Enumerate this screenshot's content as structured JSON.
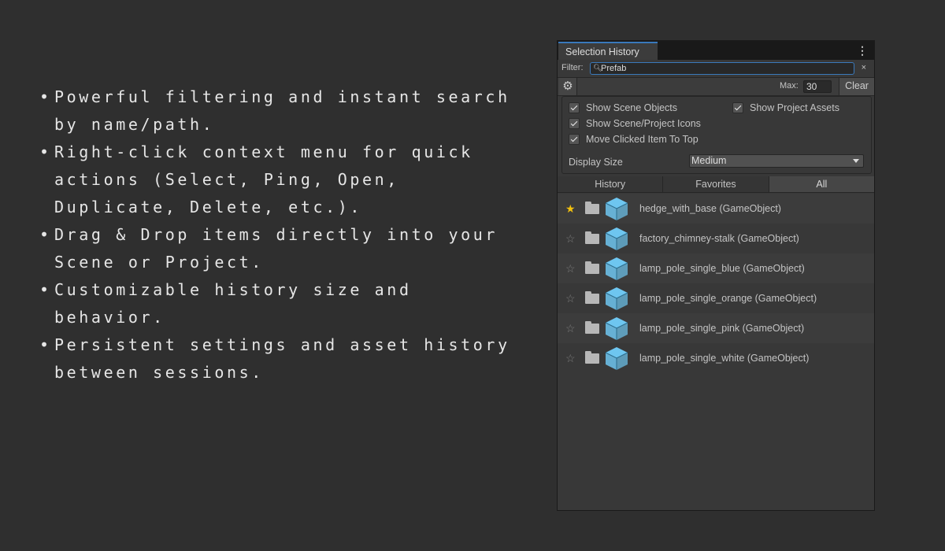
{
  "features": [
    {
      "bullet": "•",
      "text": "Powerful filtering and instant search by name/path."
    },
    {
      "bullet": "•",
      "text": "Right-click context menu for quick actions (Select, Ping, Open, Duplicate, Delete, etc.)."
    },
    {
      "bullet": "•",
      "text": "Drag & Drop items directly into your Scene or Project."
    },
    {
      "bullet": "•",
      "text": "Customizable history size and behavior."
    },
    {
      "bullet": "•",
      "text": "Persistent settings and asset history between sessions."
    }
  ],
  "window": {
    "title": "Selection History",
    "menu_icon": "kebab-menu-icon",
    "filter": {
      "label": "Filter:",
      "value": "Prefab",
      "search_icon": "search-icon",
      "clear_glyph": "×"
    },
    "toolbar": {
      "settings_icon": "gear-icon",
      "max_label": "Max:",
      "max_value": "30",
      "clear_label": "Clear"
    },
    "settings": {
      "show_scene_objects": {
        "label": "Show Scene Objects",
        "checked": true
      },
      "show_project_assets": {
        "label": "Show Project Assets",
        "checked": true
      },
      "show_icons": {
        "label": "Show Scene/Project Icons",
        "checked": true
      },
      "move_to_top": {
        "label": "Move Clicked Item To Top",
        "checked": true
      },
      "display_size_label": "Display Size",
      "display_size_value": "Medium"
    },
    "tabs": [
      {
        "label": "History",
        "active": false
      },
      {
        "label": "Favorites",
        "active": false
      },
      {
        "label": "All",
        "active": true
      }
    ],
    "items": [
      {
        "name": "hedge_with_base (GameObject)",
        "favorite": true
      },
      {
        "name": "factory_chimney-stalk (GameObject)",
        "favorite": false
      },
      {
        "name": "lamp_pole_single_blue (GameObject)",
        "favorite": false
      },
      {
        "name": "lamp_pole_single_orange (GameObject)",
        "favorite": false
      },
      {
        "name": "lamp_pole_single_pink (GameObject)",
        "favorite": false
      },
      {
        "name": "lamp_pole_single_white (GameObject)",
        "favorite": false
      }
    ],
    "colors": {
      "accent": "#3a79bb",
      "favorite_star": "#f3c10e",
      "prefab_cube": "#6ec6f0"
    }
  }
}
